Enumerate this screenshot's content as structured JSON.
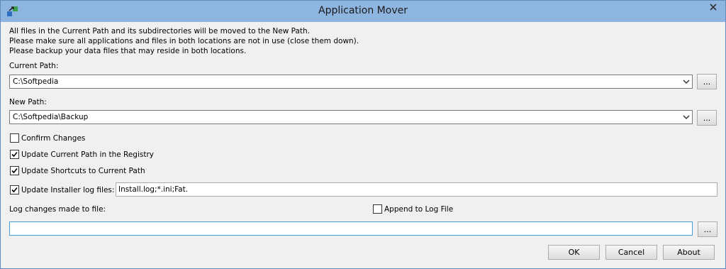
{
  "window": {
    "title": "Application Mover"
  },
  "info": {
    "line1": "All files in the Current Path and its subdirectories will be moved to the New Path.",
    "line2": "Please make sure all applications and files in both locations are not in use (close them down).",
    "line3": "Please backup your data files that may reside in both locations."
  },
  "current_path": {
    "label": "Current Path:",
    "value": "C:\\Softpedia",
    "browse_label": "..."
  },
  "new_path": {
    "label": "New Path:",
    "value": "C:\\Softpedia\\Backup",
    "browse_label": "..."
  },
  "options": {
    "confirm_changes": {
      "label": "Confirm Changes",
      "checked": false
    },
    "update_registry": {
      "label": "Update Current Path in the Registry",
      "checked": true
    },
    "update_shortcuts": {
      "label": "Update Shortcuts to Current Path",
      "checked": true
    },
    "update_installer_logs": {
      "label": "Update Installer log files:",
      "checked": true,
      "value": "Install.log;*.ini;Fat."
    }
  },
  "log": {
    "label": "Log changes made to file:",
    "append_label": "Append to Log File",
    "append_checked": false,
    "value": "",
    "browse_label": "..."
  },
  "buttons": {
    "ok": "OK",
    "cancel": "Cancel",
    "about": "About"
  },
  "icons": {
    "app": "app-mover-icon",
    "close": "close-icon",
    "dropdown": "chevron-down-icon",
    "check": "checkmark-icon"
  }
}
